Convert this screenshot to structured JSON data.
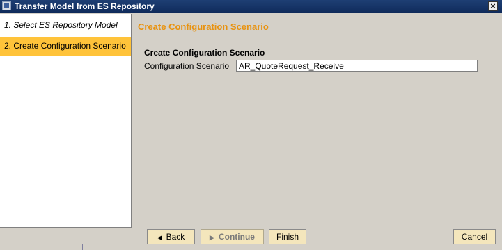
{
  "window": {
    "title": "Transfer Model from ES Repository",
    "close_label": "×"
  },
  "steps": [
    {
      "label": "1. Select ES Repository Model"
    },
    {
      "label": "2. Create Configuration Scenario"
    }
  ],
  "main": {
    "section_title": "Create Configuration Scenario",
    "group_title": "Create Configuration Scenario",
    "field_label": "Configuration Scenario",
    "field_value": "AR_QuoteRequest_Receive"
  },
  "buttons": {
    "back": "Back",
    "continue": "Continue",
    "finish": "Finish",
    "cancel": "Cancel"
  },
  "colors": {
    "title_bar": "#1e3f74",
    "selected_step": "#ffc33a",
    "section_title": "#e8920f",
    "button_bg": "#f4e6bc"
  }
}
